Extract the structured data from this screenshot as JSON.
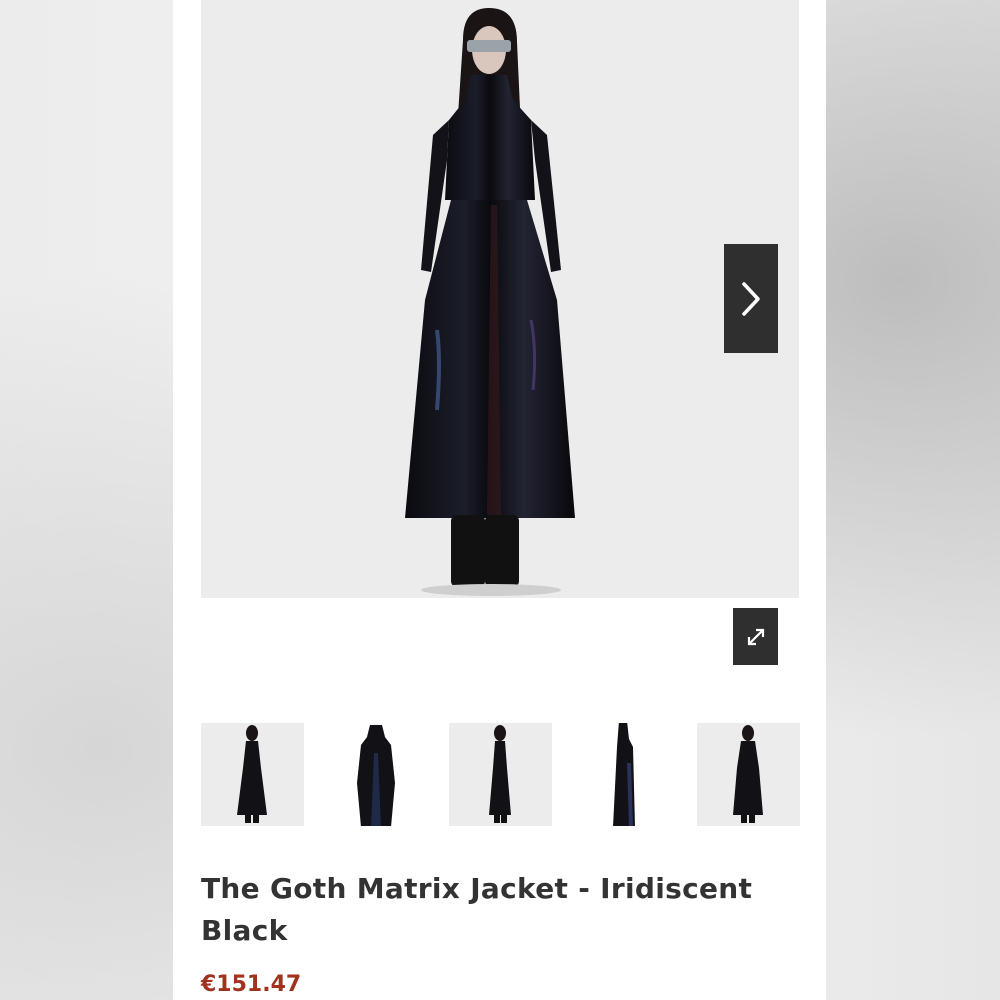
{
  "product": {
    "title": "The Goth Matrix Jacket - Iridiscent Black",
    "price": "€151.47"
  },
  "gallery": {
    "next_icon": "chevron-right-icon",
    "expand_icon": "expand-arrows-icon",
    "thumbnail_count": 5
  },
  "colors": {
    "price": "#a0321e",
    "overlay_buttons": "#2f2f2f",
    "title": "#333333"
  }
}
